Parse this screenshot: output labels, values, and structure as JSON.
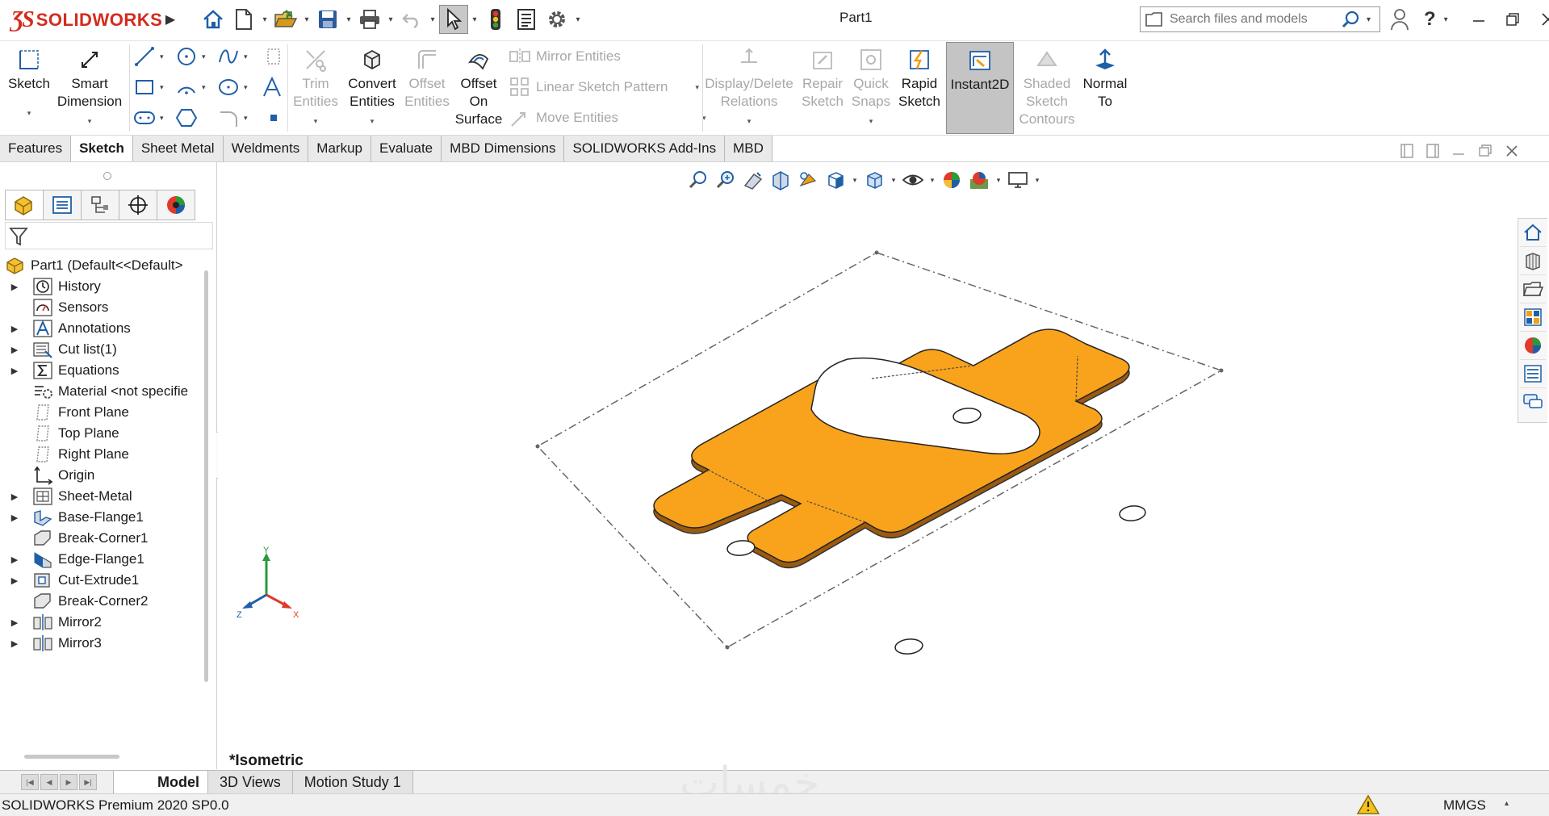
{
  "app": {
    "brand": "SOLIDWORKS",
    "document_title": "Part1"
  },
  "search": {
    "placeholder": "Search files and models"
  },
  "ribbon": {
    "sketch": "Sketch",
    "smart_dimension_1": "Smart",
    "smart_dimension_2": "Dimension",
    "trim_1": "Trim",
    "trim_2": "Entities",
    "convert_1": "Convert",
    "convert_2": "Entities",
    "offset_1": "Offset",
    "offset_2": "Entities",
    "offset_surface_1": "Offset",
    "offset_surface_2": "On",
    "offset_surface_3": "Surface",
    "mirror_entities": "Mirror Entities",
    "linear_pattern": "Linear Sketch Pattern",
    "move_entities": "Move Entities",
    "display_delete_1": "Display/Delete",
    "display_delete_2": "Relations",
    "repair_1": "Repair",
    "repair_2": "Sketch",
    "quick_snaps_1": "Quick",
    "quick_snaps_2": "Snaps",
    "rapid_1": "Rapid",
    "rapid_2": "Sketch",
    "instant2d": "Instant2D",
    "shaded_1": "Shaded",
    "shaded_2": "Sketch",
    "shaded_3": "Contours",
    "normal_1": "Normal",
    "normal_2": "To"
  },
  "tabs": [
    "Features",
    "Sketch",
    "Sheet Metal",
    "Weldments",
    "Markup",
    "Evaluate",
    "MBD Dimensions",
    "SOLIDWORKS Add-Ins",
    "MBD"
  ],
  "tree": {
    "root": "Part1  (Default<<Default>",
    "items": [
      {
        "label": "History"
      },
      {
        "label": "Sensors"
      },
      {
        "label": "Annotations"
      },
      {
        "label": "Cut list(1)"
      },
      {
        "label": "Equations"
      },
      {
        "label": "Material <not specifie"
      },
      {
        "label": "Front Plane"
      },
      {
        "label": "Top Plane"
      },
      {
        "label": "Right Plane"
      },
      {
        "label": "Origin"
      },
      {
        "label": "Sheet-Metal"
      },
      {
        "label": "Base-Flange1"
      },
      {
        "label": "Break-Corner1"
      },
      {
        "label": "Edge-Flange1"
      },
      {
        "label": "Cut-Extrude1"
      },
      {
        "label": "Break-Corner2"
      },
      {
        "label": "Mirror2"
      },
      {
        "label": "Mirror3"
      }
    ]
  },
  "viewport": {
    "view_name": "*Isometric",
    "triad": {
      "x": "X",
      "y": "Y",
      "z": "Z"
    },
    "part_color": "#f9a21b"
  },
  "bottom_tabs": [
    "Model",
    "3D Views",
    "Motion Study 1"
  ],
  "watermark": "خمسات",
  "status": {
    "product": "SOLIDWORKS Premium 2020 SP0.0",
    "units": "MMGS"
  },
  "colors": {
    "brand_red": "#d52b1e",
    "accent_blue": "#1f5fa8",
    "part_orange": "#f9a21b"
  }
}
